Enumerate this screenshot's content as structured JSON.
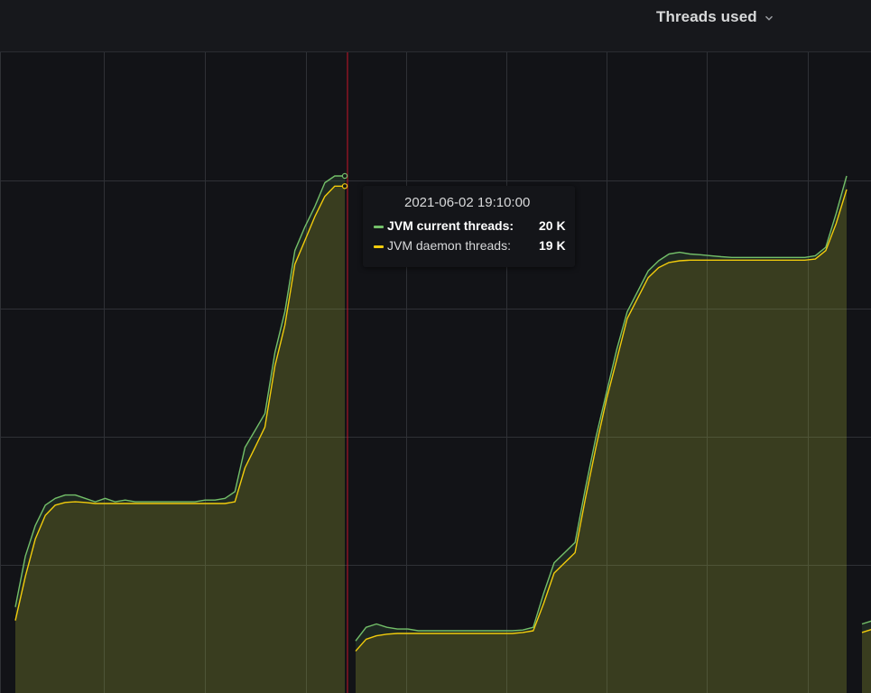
{
  "panel": {
    "title": "Threads used"
  },
  "colors": {
    "background": "#121317",
    "grid": "#2f3136",
    "current": "#73bf69",
    "daemon": "#f2cc0c",
    "fill": "#3a3a2a",
    "cursor": "#c4162a"
  },
  "tooltip": {
    "time": "2021-06-02 19:10:00",
    "rows": [
      {
        "name": "JVM current threads:",
        "value": "20 K",
        "color": "#73bf69"
      },
      {
        "name": "JVM daemon threads:",
        "value": "19 K",
        "color": "#f2cc0c"
      }
    ]
  },
  "chart_data": {
    "type": "area",
    "title": "Threads used",
    "grid": true,
    "ylim": [
      6.6,
      20.5
    ],
    "y_unit": "K",
    "cursor_x": 33,
    "series": [
      {
        "name": "JVM current threads",
        "color": "#73bf69",
        "points": [
          [
            0,
            7.3
          ],
          [
            1,
            8.8
          ],
          [
            2,
            9.7
          ],
          [
            3,
            10.3
          ],
          [
            4,
            10.5
          ],
          [
            5,
            10.6
          ],
          [
            6,
            10.6
          ],
          [
            7,
            10.5
          ],
          [
            8,
            10.4
          ],
          [
            9,
            10.5
          ],
          [
            10,
            10.4
          ],
          [
            11,
            10.45
          ],
          [
            12,
            10.4
          ],
          [
            13,
            10.4
          ],
          [
            14,
            10.4
          ],
          [
            15,
            10.4
          ],
          [
            16,
            10.4
          ],
          [
            17,
            10.4
          ],
          [
            18,
            10.4
          ],
          [
            19,
            10.45
          ],
          [
            20,
            10.45
          ],
          [
            21,
            10.5
          ],
          [
            22,
            10.7
          ],
          [
            23,
            12.0
          ],
          [
            24,
            12.5
          ],
          [
            25,
            13.0
          ],
          [
            26,
            14.8
          ],
          [
            27,
            16.0
          ],
          [
            28,
            17.8
          ],
          [
            29,
            18.5
          ],
          [
            30,
            19.1
          ],
          [
            31,
            19.8
          ],
          [
            32,
            20.0
          ],
          [
            33,
            20.0
          ],
          null,
          [
            34,
            6.3
          ],
          [
            35,
            6.7
          ],
          [
            36,
            6.8
          ],
          [
            37,
            6.7
          ],
          [
            38,
            6.65
          ],
          [
            39,
            6.65
          ],
          [
            40,
            6.6
          ],
          [
            41,
            6.6
          ],
          [
            42,
            6.6
          ],
          [
            43,
            6.6
          ],
          [
            44,
            6.6
          ],
          [
            45,
            6.6
          ],
          [
            46,
            6.6
          ],
          [
            47,
            6.6
          ],
          [
            48,
            6.6
          ],
          [
            49,
            6.6
          ],
          [
            50,
            6.62
          ],
          [
            51,
            6.7
          ],
          [
            52,
            7.7
          ],
          [
            53,
            8.6
          ],
          [
            54,
            8.9
          ],
          [
            55,
            9.2
          ],
          [
            56,
            10.8
          ],
          [
            57,
            12.3
          ],
          [
            58,
            13.6
          ],
          [
            59,
            14.9
          ],
          [
            60,
            16.0
          ],
          [
            61,
            16.6
          ],
          [
            62,
            17.2
          ],
          [
            63,
            17.5
          ],
          [
            64,
            17.7
          ],
          [
            65,
            17.75
          ],
          [
            66,
            17.7
          ],
          [
            67,
            17.68
          ],
          [
            68,
            17.65
          ],
          [
            69,
            17.62
          ],
          [
            70,
            17.6
          ],
          [
            71,
            17.6
          ],
          [
            72,
            17.6
          ],
          [
            73,
            17.6
          ],
          [
            74,
            17.6
          ],
          [
            75,
            17.6
          ],
          [
            76,
            17.6
          ],
          [
            77,
            17.6
          ],
          [
            78,
            17.65
          ],
          [
            79,
            17.9
          ],
          [
            80,
            18.9
          ],
          [
            81,
            20.0
          ],
          null,
          [
            86,
            6.8
          ],
          [
            87,
            6.9
          ]
        ]
      },
      {
        "name": "JVM daemon threads",
        "color": "#f2cc0c",
        "points": [
          [
            0,
            6.9
          ],
          [
            1,
            8.2
          ],
          [
            2,
            9.3
          ],
          [
            3,
            10.0
          ],
          [
            4,
            10.3
          ],
          [
            5,
            10.38
          ],
          [
            6,
            10.4
          ],
          [
            7,
            10.38
          ],
          [
            8,
            10.35
          ],
          [
            9,
            10.35
          ],
          [
            10,
            10.35
          ],
          [
            11,
            10.35
          ],
          [
            12,
            10.35
          ],
          [
            13,
            10.35
          ],
          [
            14,
            10.35
          ],
          [
            15,
            10.35
          ],
          [
            16,
            10.35
          ],
          [
            17,
            10.35
          ],
          [
            18,
            10.35
          ],
          [
            19,
            10.35
          ],
          [
            20,
            10.35
          ],
          [
            21,
            10.35
          ],
          [
            22,
            10.4
          ],
          [
            23,
            11.4
          ],
          [
            24,
            12.0
          ],
          [
            25,
            12.6
          ],
          [
            26,
            14.4
          ],
          [
            27,
            15.6
          ],
          [
            28,
            17.4
          ],
          [
            29,
            18.1
          ],
          [
            30,
            18.8
          ],
          [
            31,
            19.4
          ],
          [
            32,
            19.7
          ],
          [
            33,
            19.7
          ],
          null,
          [
            34,
            6.0
          ],
          [
            35,
            6.35
          ],
          [
            36,
            6.45
          ],
          [
            37,
            6.5
          ],
          [
            38,
            6.52
          ],
          [
            39,
            6.52
          ],
          [
            40,
            6.52
          ],
          [
            41,
            6.52
          ],
          [
            42,
            6.52
          ],
          [
            43,
            6.52
          ],
          [
            44,
            6.52
          ],
          [
            45,
            6.52
          ],
          [
            46,
            6.52
          ],
          [
            47,
            6.52
          ],
          [
            48,
            6.52
          ],
          [
            49,
            6.52
          ],
          [
            50,
            6.55
          ],
          [
            51,
            6.6
          ],
          [
            52,
            7.4
          ],
          [
            53,
            8.3
          ],
          [
            54,
            8.6
          ],
          [
            55,
            8.9
          ],
          [
            56,
            10.5
          ],
          [
            57,
            12.0
          ],
          [
            58,
            13.4
          ],
          [
            59,
            14.6
          ],
          [
            60,
            15.8
          ],
          [
            61,
            16.4
          ],
          [
            62,
            17.0
          ],
          [
            63,
            17.3
          ],
          [
            64,
            17.45
          ],
          [
            65,
            17.5
          ],
          [
            66,
            17.52
          ],
          [
            67,
            17.52
          ],
          [
            68,
            17.52
          ],
          [
            69,
            17.52
          ],
          [
            70,
            17.52
          ],
          [
            71,
            17.52
          ],
          [
            72,
            17.52
          ],
          [
            73,
            17.52
          ],
          [
            74,
            17.52
          ],
          [
            75,
            17.52
          ],
          [
            76,
            17.52
          ],
          [
            77,
            17.52
          ],
          [
            78,
            17.55
          ],
          [
            79,
            17.8
          ],
          [
            80,
            18.6
          ],
          [
            81,
            19.6
          ],
          null,
          [
            86,
            6.55
          ],
          [
            87,
            6.65
          ]
        ]
      }
    ]
  }
}
